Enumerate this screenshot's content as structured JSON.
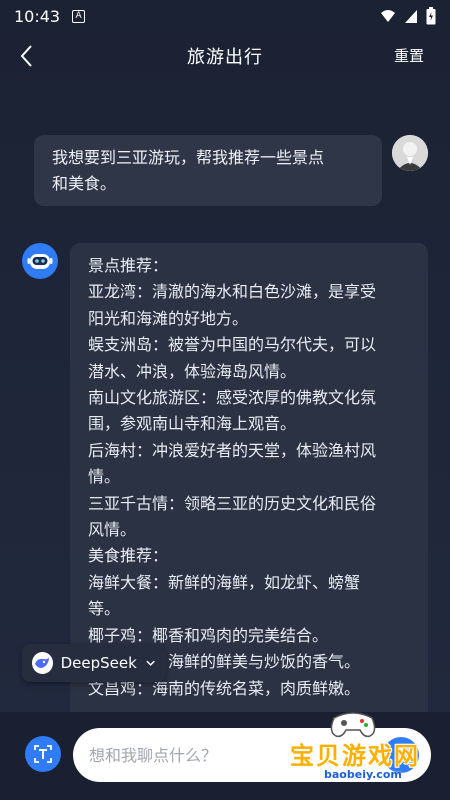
{
  "status_bar": {
    "time": "10:43",
    "indicator": "A"
  },
  "header": {
    "title": "旅游出行",
    "reset_label": "重置"
  },
  "user_message": "我想要到三亚游玩，帮我推荐一些景点和美食。",
  "user_message_lines": [
    "我想要到三亚游玩，帮我推荐一些景点",
    "和美食。"
  ],
  "bot_message_lines": [
    "景点推荐：",
    "亚龙湾：清澈的海水和白色沙滩，是享受",
    "阳光和海滩的好地方。",
    "蜈支洲岛：被誉为中国的马尔代夫，可以",
    "潜水、冲浪，体验海岛风情。",
    "南山文化旅游区：感受浓厚的佛教文化氛",
    "围，参观南山寺和海上观音。",
    "后海村：冲浪爱好者的天堂，体验渔村风",
    "情。",
    "三亚千古情：领略三亚的历史文化和民俗",
    "风情。",
    "美食推荐：",
    "海鲜大餐：新鲜的海鲜，如龙虾、螃蟹",
    "等。",
    "椰子鸡：椰香和鸡肉的完美结合。",
    "海鲜炒饭：海鲜的鲜美与炒饭的香气。",
    "文昌鸡：海南的传统名菜，肉质鲜嫩。"
  ],
  "model_selector": {
    "label": "DeepSeek"
  },
  "input": {
    "placeholder": "想和我聊点什么？",
    "value": ""
  },
  "watermark": {
    "text": "宝贝游戏网",
    "url": "baobeiy.com"
  },
  "colors": {
    "accent": "#2f7cf6",
    "background": "#1e2538",
    "bubble": "#2b3244"
  }
}
